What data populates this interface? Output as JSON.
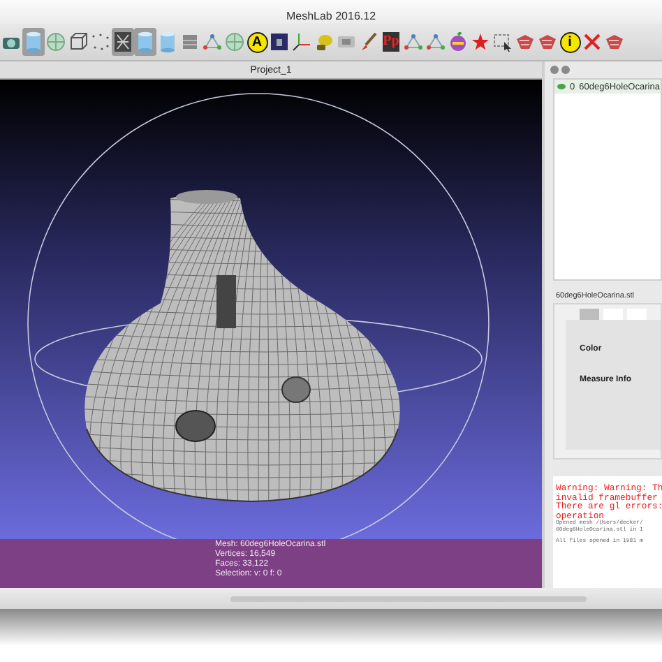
{
  "window": {
    "title": "MeshLab 2016.12"
  },
  "toolbar": [
    {
      "kind": "camera",
      "selected": false
    },
    {
      "kind": "cylinder",
      "selected": true
    },
    {
      "kind": "sphere",
      "selected": false
    },
    {
      "kind": "box",
      "selected": false
    },
    {
      "kind": "points",
      "selected": false
    },
    {
      "kind": "wire",
      "selected": true
    },
    {
      "kind": "cylinder",
      "selected": true
    },
    {
      "kind": "cylinder",
      "selected": false
    },
    {
      "kind": "layers",
      "selected": false
    },
    {
      "kind": "graph",
      "selected": false
    },
    {
      "kind": "sphere",
      "selected": false
    },
    {
      "kind": "letter",
      "glyph": "A",
      "selected": false
    },
    {
      "kind": "tex",
      "selected": false
    },
    {
      "kind": "axes",
      "selected": false
    },
    {
      "kind": "lamp",
      "selected": false
    },
    {
      "kind": "copy",
      "selected": false
    },
    {
      "kind": "brush",
      "selected": false
    },
    {
      "kind": "logo",
      "glyph": "Pp",
      "selected": false
    },
    {
      "kind": "graph",
      "selected": false
    },
    {
      "kind": "graph",
      "selected": false
    },
    {
      "kind": "color",
      "selected": false
    },
    {
      "kind": "star",
      "selected": false
    },
    {
      "kind": "select",
      "selected": false
    },
    {
      "kind": "paint",
      "selected": false
    },
    {
      "kind": "paint",
      "selected": false
    },
    {
      "kind": "letter",
      "glyph": "i",
      "selected": false
    },
    {
      "kind": "delete",
      "selected": false
    },
    {
      "kind": "paint",
      "selected": false
    }
  ],
  "viewport": {
    "tab": "Project_1",
    "info": [
      "Mesh: 60deg6HoleOcarina.stl",
      "Vertices: 16,549",
      "Faces: 33,122",
      "Selection: v: 0 f: 0"
    ]
  },
  "layers": [
    {
      "index": "0",
      "name": "60deg6HoleOcarina",
      "visible": true
    }
  ],
  "mesh_label": "60deg6HoleOcarina.stl",
  "decorator": {
    "tabs": [
      {
        "selected": true
      },
      {
        "selected": false
      },
      {
        "selected": false
      }
    ],
    "items": [
      "Color",
      "Measure Info"
    ]
  },
  "log": [
    {
      "kind": "error",
      "text": "Warning: Warning: Th"
    },
    {
      "kind": "error",
      "text": "invalid framebuffer"
    },
    {
      "kind": "error",
      "text": "There are gl errors:"
    },
    {
      "kind": "error",
      "text": "operation"
    },
    {
      "kind": "info",
      "text": "Opened mesh /Users/decker/"
    },
    {
      "kind": "info",
      "text": "60deg6HoleOcarina.stl in 1"
    },
    {
      "kind": "summary",
      "text": "All files opened in 1981 m"
    }
  ]
}
